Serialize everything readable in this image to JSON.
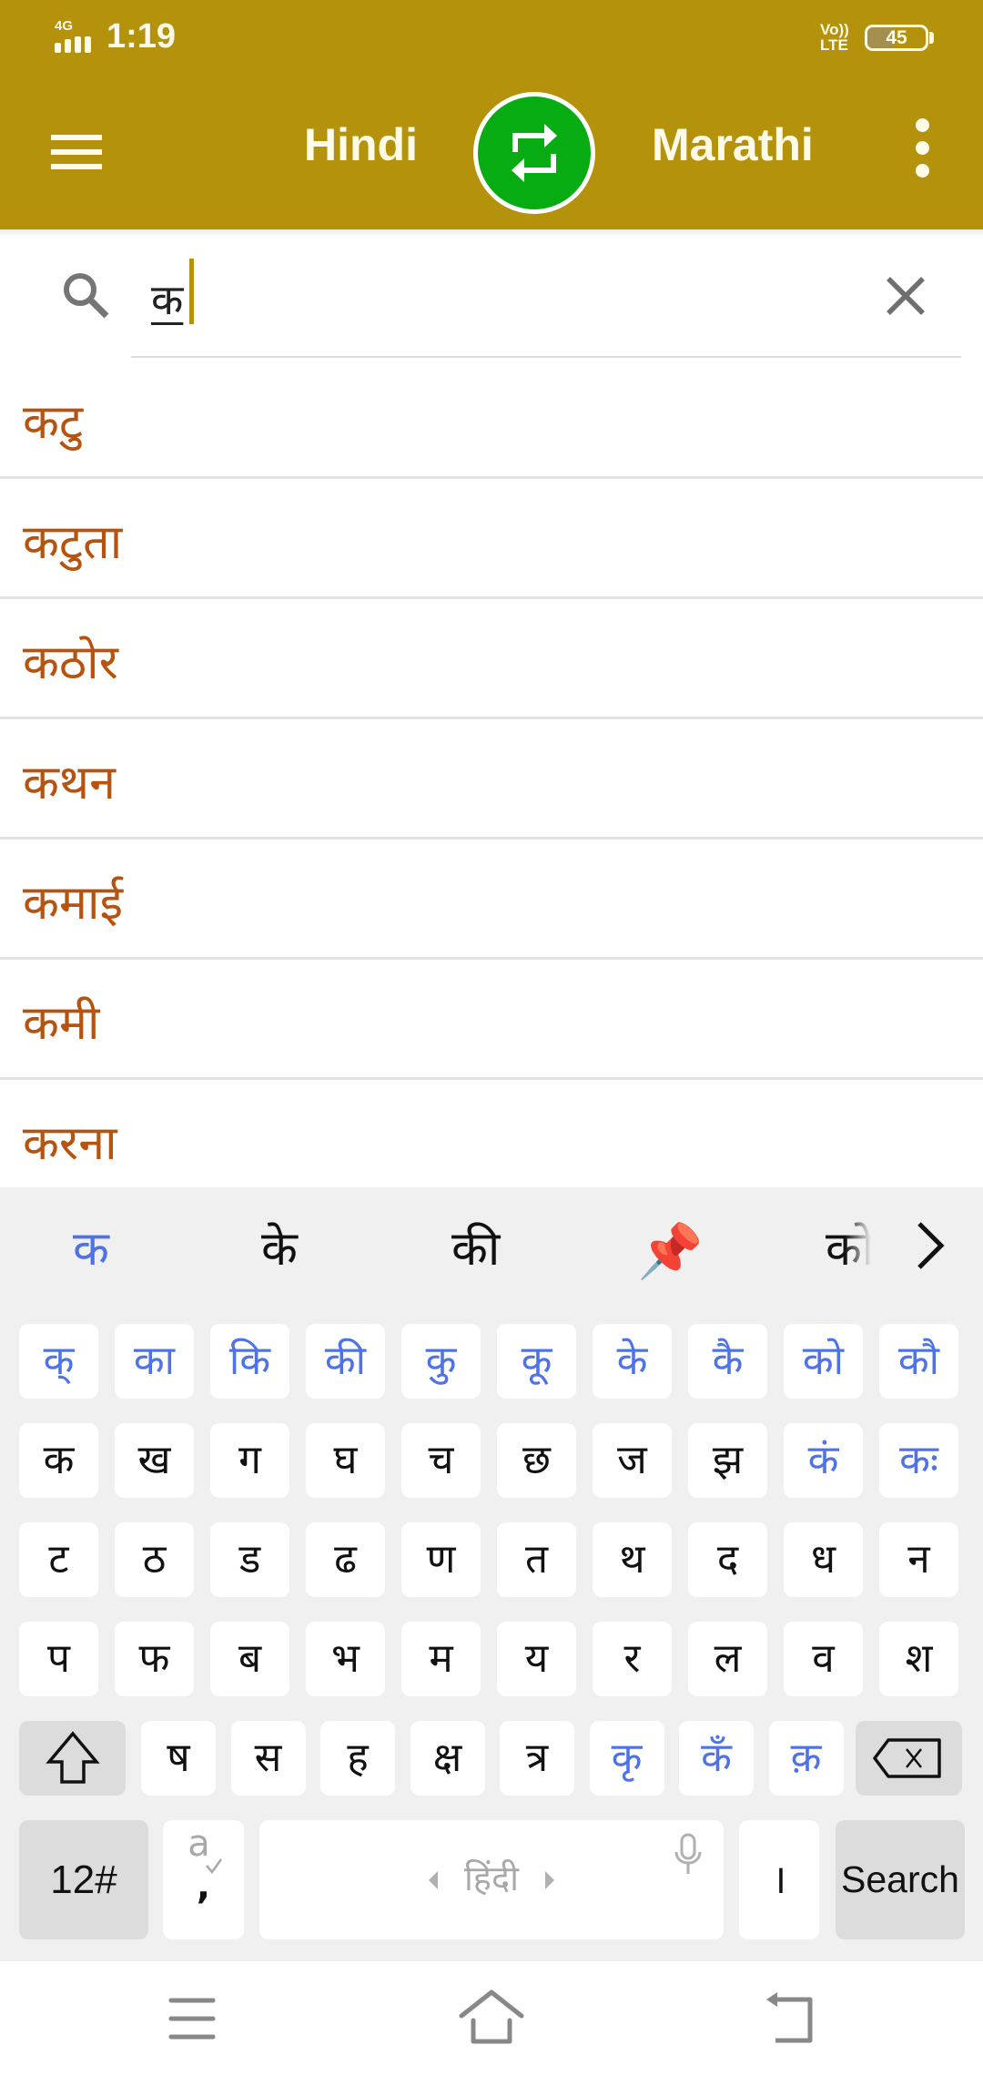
{
  "status_bar": {
    "network_type": "4G",
    "time": "1:19",
    "volte_line1": "Vo))",
    "volte_line2": "LTE",
    "battery_percent": 45,
    "battery_label": "45"
  },
  "app_bar": {
    "menu_icon": "hamburger-menu-icon",
    "source_language": "Hindi",
    "swap_icon": "swap-arrows-icon",
    "target_language": "Marathi",
    "more_icon": "more-vertical-icon",
    "bar_color": "#b5920b",
    "swap_color": "#06ac11"
  },
  "search": {
    "icon": "search-icon",
    "value": "क",
    "clear_icon": "close-icon",
    "cursor_color": "#b5920b"
  },
  "results": [
    {
      "word": "कटु"
    },
    {
      "word": "कटुता"
    },
    {
      "word": "कठोर"
    },
    {
      "word": "कथन"
    },
    {
      "word": "कमाई"
    },
    {
      "word": "कमी"
    },
    {
      "word": "करना"
    }
  ],
  "result_text_color": "#b6540f",
  "keyboard": {
    "suggestions": [
      {
        "text": "क",
        "active": true
      },
      {
        "text": "के"
      },
      {
        "text": "की"
      },
      {
        "text": "📌",
        "semantic": "pin-clipboard-icon"
      },
      {
        "text": "को",
        "faded": true
      }
    ],
    "suggestions_more_icon": "chevron-right-icon",
    "rows": [
      [
        "क्",
        "का",
        "कि",
        "की",
        "कु",
        "कू",
        "के",
        "कै",
        "को",
        "कौ"
      ],
      [
        "क",
        "ख",
        "ग",
        "घ",
        "च",
        "छ",
        "ज",
        "झ",
        "कं",
        "कः"
      ],
      [
        "ट",
        "ठ",
        "ड",
        "ढ",
        "ण",
        "त",
        "थ",
        "द",
        "ध",
        "न"
      ],
      [
        "प",
        "फ",
        "ब",
        "भ",
        "म",
        "य",
        "र",
        "ल",
        "व",
        "श"
      ],
      [
        "ष",
        "स",
        "ह",
        "क्ष",
        "त्र",
        "कृ",
        "कँ",
        "क़"
      ]
    ],
    "blue_keys": [
      "क्",
      "का",
      "कि",
      "की",
      "कु",
      "कू",
      "के",
      "कै",
      "को",
      "कौ",
      "कं",
      "कः",
      "कृ",
      "कँ",
      "क़"
    ],
    "shift_icon": "shift-arrow-icon",
    "backspace_icon": "backspace-icon",
    "symbols_key": "12#",
    "comma_key": ",",
    "comma_key_hint": "a",
    "comma_hint_icon": "spellcheck-icon",
    "space_label": "हिंदी",
    "space_left_icon": "triangle-left-icon",
    "space_right_icon": "triangle-right-icon",
    "mic_icon": "microphone-icon",
    "danda_key": "।",
    "action_key": "Search",
    "accent_color": "#4f73e6"
  },
  "nav_bar": {
    "recents_icon": "recents-menu-icon",
    "home_icon": "home-icon",
    "back_icon": "back-icon"
  }
}
